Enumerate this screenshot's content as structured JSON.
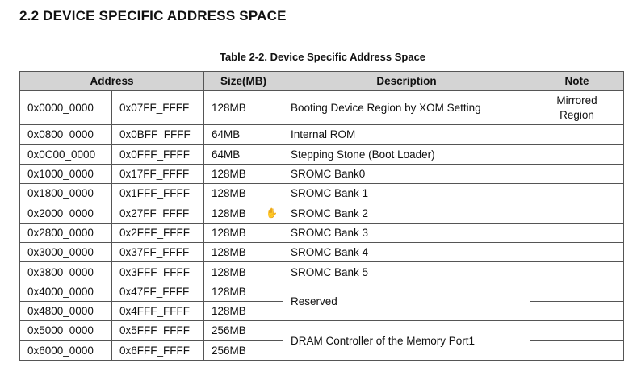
{
  "section_title": "2.2 DEVICE SPECIFIC ADDRESS SPACE",
  "table_caption": "Table 2-2.  Device Specific Address Space",
  "headers": {
    "address": "Address",
    "size": "Size(MB)",
    "description": "Description",
    "note": "Note"
  },
  "rows": [
    {
      "start": "0x0000_0000",
      "end": "0x07FF_FFFF",
      "size": "128MB",
      "description": "Booting Device Region by XOM Setting",
      "note": "Mirrored Region"
    },
    {
      "start": "0x0800_0000",
      "end": "0x0BFF_FFFF",
      "size": "64MB",
      "description": "Internal ROM",
      "note": ""
    },
    {
      "start": "0x0C00_0000",
      "end": "0x0FFF_FFFF",
      "size": "64MB",
      "description": "Stepping Stone (Boot Loader)",
      "note": ""
    },
    {
      "start": "0x1000_0000",
      "end": "0x17FF_FFFF",
      "size": "128MB",
      "description": "SROMC Bank0",
      "note": ""
    },
    {
      "start": "0x1800_0000",
      "end": "0x1FFF_FFFF",
      "size": "128MB",
      "description": "SROMC Bank 1",
      "note": ""
    },
    {
      "start": "0x2000_0000",
      "end": "0x27FF_FFFF",
      "size": "128MB",
      "description": "SROMC Bank 2",
      "note": ""
    },
    {
      "start": "0x2800_0000",
      "end": "0x2FFF_FFFF",
      "size": "128MB",
      "description": "SROMC Bank 3",
      "note": ""
    },
    {
      "start": "0x3000_0000",
      "end": "0x37FF_FFFF",
      "size": "128MB",
      "description": "SROMC Bank 4",
      "note": ""
    },
    {
      "start": "0x3800_0000",
      "end": "0x3FFF_FFFF",
      "size": "128MB",
      "description": "SROMC Bank 5",
      "note": ""
    },
    {
      "start": "0x4000_0000",
      "end": "0x47FF_FFFF",
      "size": "128MB",
      "description": "Reserved",
      "note": ""
    },
    {
      "start": "0x4800_0000",
      "end": "0x4FFF_FFFF",
      "size": "128MB",
      "note": ""
    },
    {
      "start": "0x5000_0000",
      "end": "0x5FFF_FFFF",
      "size": "256MB",
      "description": "DRAM Controller of the Memory Port1",
      "note": ""
    },
    {
      "start": "0x6000_0000",
      "end": "0x6FFF_FFFF",
      "size": "256MB",
      "note": ""
    }
  ],
  "cursor_icon": "hand-cursor-icon"
}
